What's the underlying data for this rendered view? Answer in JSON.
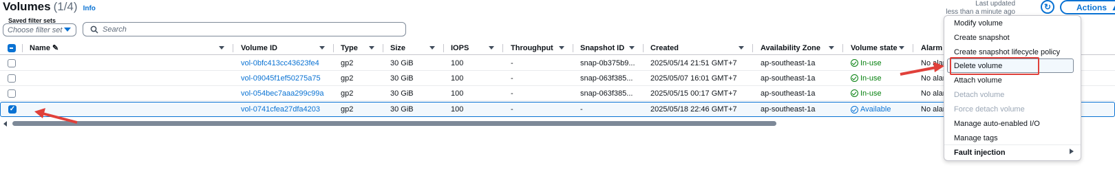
{
  "header": {
    "title": "Volumes",
    "count": "(1/4)",
    "info": "Info",
    "last_updated": "Last updated",
    "last_updated_when": "less than a minute ago",
    "actions_label": "Actions"
  },
  "filters": {
    "saved_label": "Saved filter sets",
    "saved_placeholder": "Choose filter set",
    "search_placeholder": "Search"
  },
  "columns": [
    "Name",
    "Volume ID",
    "Type",
    "Size",
    "IOPS",
    "Throughput",
    "Snapshot ID",
    "Created",
    "Availability Zone",
    "Volume state",
    "Alarm s"
  ],
  "rows": [
    {
      "volume_id": "vol-0bfc413cc43623fe4",
      "type": "gp2",
      "size": "30 GiB",
      "iops": "100",
      "throughput": "-",
      "snapshot": "snap-0b375b9...",
      "created": "2025/05/14 21:51 GMT+7",
      "az": "ap-southeast-1a",
      "state": "In-use",
      "alarm": "No alar",
      "selected": false
    },
    {
      "volume_id": "vol-09045f1ef50275a75",
      "type": "gp2",
      "size": "30 GiB",
      "iops": "100",
      "throughput": "-",
      "snapshot": "snap-063f385...",
      "created": "2025/05/07 16:01 GMT+7",
      "az": "ap-southeast-1a",
      "state": "In-use",
      "alarm": "No alar",
      "selected": false
    },
    {
      "volume_id": "vol-054bec7aaa299c99a",
      "type": "gp2",
      "size": "30 GiB",
      "iops": "100",
      "throughput": "-",
      "snapshot": "snap-063f385...",
      "created": "2025/05/15 00:17 GMT+7",
      "az": "ap-southeast-1a",
      "state": "In-use",
      "alarm": "No alar",
      "selected": false
    },
    {
      "volume_id": "vol-0741cfea27dfa4203",
      "type": "gp2",
      "size": "30 GiB",
      "iops": "100",
      "throughput": "-",
      "snapshot": "-",
      "created": "2025/05/18 22:46 GMT+7",
      "az": "ap-southeast-1a",
      "state": "Available",
      "alarm": "No alar",
      "selected": true
    }
  ],
  "actions_menu": {
    "items": [
      {
        "label": "Modify volume",
        "disabled": false
      },
      {
        "label": "Create snapshot",
        "disabled": false
      },
      {
        "label": "Create snapshot lifecycle policy",
        "disabled": false
      },
      {
        "label": "Delete volume",
        "disabled": false,
        "highlighted": true
      },
      {
        "label": "Attach volume",
        "disabled": false
      },
      {
        "label": "Detach volume",
        "disabled": true
      },
      {
        "label": "Force detach volume",
        "disabled": true
      },
      {
        "label": "Manage auto-enabled I/O",
        "disabled": false
      },
      {
        "label": "Manage tags",
        "disabled": false
      }
    ],
    "group_label": "Fault injection"
  },
  "colors": {
    "link": "#0972d3",
    "success": "#037f0c",
    "annotation": "#e0403a"
  }
}
